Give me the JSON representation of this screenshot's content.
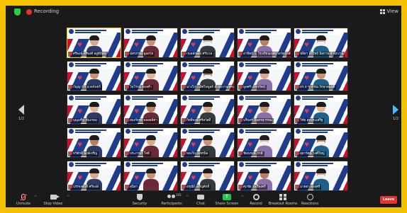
{
  "app": {
    "recording_label": "Recording",
    "view_label": "View"
  },
  "nav": {
    "prev_page": "1/2",
    "next_page": "1/2"
  },
  "participants": [
    {
      "name": "ศรีพงษ์ ศรีพงศ์ อยู่ดีมีสุข",
      "speaking": true,
      "mask": false
    },
    {
      "name": "ฉัตรภรณ์ พูลสวัส",
      "speaking": false,
      "mask": false
    },
    {
      "name": "กมลลักษณ์ ศรีนวล",
      "speaking": false,
      "mask": true
    },
    {
      "name": "อาทิตย์ ว. โรงเรียนเทศบาลวัดป่าสัก",
      "speaking": false,
      "mask": false
    },
    {
      "name": "ชลิตา จิรวิทย์ นิลกาย สำนักงาน",
      "speaking": false,
      "mask": true
    },
    {
      "name": "กัญญาวีร์ นวลจันทร์",
      "speaking": false,
      "mask": false
    },
    {
      "name": "ไพโรจน์ ทองคำ",
      "speaking": false,
      "mask": false
    },
    {
      "name": "นางวิภา เลิศไพบูลย์ สำนักงานกศน.",
      "speaking": false,
      "mask": true
    },
    {
      "name": "พูลศรี เพ็ชรรัตน์",
      "speaking": false,
      "mask": false
    },
    {
      "name": "ดร.จารุวรรณ รักษาสมบัติ",
      "speaking": false,
      "mask": false
    },
    {
      "name": "บุญเสริม คุ้มเกษม",
      "speaking": false,
      "mask": false
    },
    {
      "name": "สมเกียรติ พลอยมีค่า",
      "speaking": false,
      "mask": false
    },
    {
      "name": "กิตติพงษ์ ศรีสวัสดิ์",
      "speaking": false,
      "mask": false
    },
    {
      "name": "นรินทร์ อินทรสุวรรณ",
      "speaking": false,
      "mask": false
    },
    {
      "name": "วิชัย สุดประเสริฐ",
      "speaking": false,
      "mask": false
    },
    {
      "name": "ทวีศักดิ์ พงษ์เจริญ",
      "speaking": false,
      "mask": false
    },
    {
      "name": "ประภาพร ใจดี",
      "speaking": false,
      "mask": false
    },
    {
      "name": "ทองใบ เพชรนิล",
      "speaking": false,
      "mask": false
    },
    {
      "name": "ชัยณรงค์ ภักดี",
      "speaking": false,
      "mask": true
    },
    {
      "name": "สุดารัตน์ วงศ์ใหญ่",
      "speaking": false,
      "mask": true
    },
    {
      "name": "บรรจงศักดิ์ ศรีพงษ์",
      "speaking": false,
      "mask": false
    },
    {
      "name": "สุนิสา",
      "speaking": false,
      "mask": false
    },
    {
      "name": "อรุณีย์ เจริญศักดิ์",
      "speaking": false,
      "mask": false
    },
    {
      "name": "ศุภชัย รุ่งเรืองศรี",
      "speaking": false,
      "mask": false
    },
    {
      "name": "นาตยา ทองศรี",
      "speaking": false,
      "mask": true
    }
  ],
  "toolbar": {
    "unmute": "Unmute",
    "stop_video": "Stop Video",
    "security": "Security",
    "participants": "Participants",
    "participants_count": "105",
    "chat": "Chat",
    "share_screen": "Share Screen",
    "record": "Record",
    "breakout_rooms": "Breakout Rooms",
    "reactions": "Reactions",
    "leave": "Leave"
  },
  "colors": {
    "frame": "#f2c200",
    "leave": "#e5322d",
    "share": "#23c552"
  }
}
